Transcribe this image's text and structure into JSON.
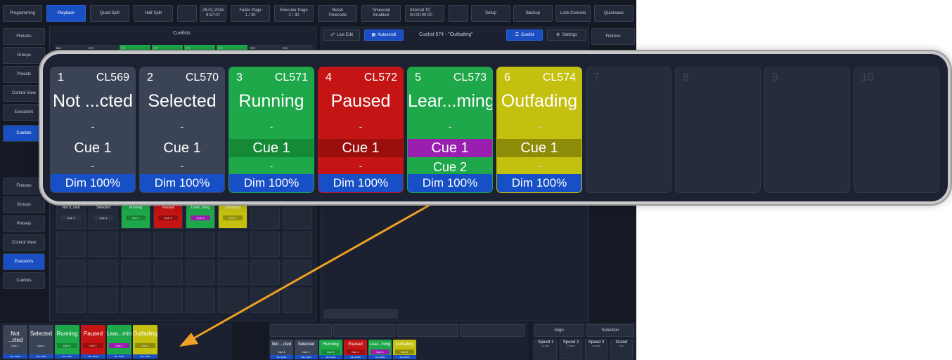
{
  "colors": {
    "accent_blue": "#1a4fc4",
    "green": "#1ea84a",
    "red": "#c41414",
    "purple": "#9a1fb0",
    "yellow": "#c4c010",
    "arrow": "#f0a024",
    "panel_bg": "#1b2130"
  },
  "topbar": {
    "b1": "Programming",
    "b2": "Playback",
    "b3": "Quad Split",
    "b4": "Half Split",
    "date": "25.01.2016",
    "time": "9:57:07",
    "fader_page_label": "Fader Page",
    "fader_page_value": "1 / 30",
    "exec_page_label": "Executor Page",
    "exec_page_value": "2 / 30",
    "reset_label": "Reset",
    "reset_sub": "Timecode",
    "timecode_label": "Timecode",
    "timecode_sub": "Enabled",
    "internal_tc_label": "Internal TC",
    "internal_tc_value": "00:00:00:00",
    "setup": "Setup",
    "backup": "Backup",
    "lock": "Lock Console",
    "quickmode": "Quicksave"
  },
  "left_top": [
    "Fixtures",
    "Groups",
    "Presets",
    "Control View",
    "Executors",
    "Cuelists"
  ],
  "left_bottom": [
    "Fixtures",
    "Groups",
    "Presets",
    "Control View",
    "Executors",
    "Cuelists"
  ],
  "right": {
    "fixtures": "Fixtures",
    "align": "Align",
    "selection": "Selection"
  },
  "cuelists_panel": {
    "title": "Cuelists",
    "band": [
      "569",
      "570",
      "571",
      "572",
      "573",
      "574",
      "575",
      "576"
    ]
  },
  "cuelist_view": {
    "live_edit": "Live Edit",
    "autoscroll": "Autoscroll",
    "title": "Cuelist 574 - \"Outfading\"",
    "cuelist_btn": "Cuelist",
    "settings_btn": "Settings"
  },
  "small_cells": [
    {
      "name": "Not S..cted",
      "cue": "Cue 1"
    },
    {
      "name": "Selected",
      "cue": "Cue 1"
    },
    {
      "name": "Running",
      "cue": "Cue 1"
    },
    {
      "name": "Paused",
      "cue": "Cue 1"
    },
    {
      "name": "Learn..ming",
      "cue": "Cue 1"
    },
    {
      "name": "Outfading",
      "cue": "Cue 1"
    }
  ],
  "zoom": {
    "cells": [
      {
        "num": "1",
        "cl": "CL569",
        "name": "Not ...cted",
        "dash1": "-",
        "cue": "Cue 1",
        "dash2": "-",
        "dim": "Dim 100%"
      },
      {
        "num": "2",
        "cl": "CL570",
        "name": "Selected",
        "dash1": "-",
        "cue": "Cue 1",
        "dash2": "-",
        "dim": "Dim 100%"
      },
      {
        "num": "3",
        "cl": "CL571",
        "name": "Running",
        "dash1": "-",
        "cue": "Cue 1",
        "dash2": "-",
        "dim": "Dim 100%"
      },
      {
        "num": "4",
        "cl": "CL572",
        "name": "Paused",
        "dash1": "-",
        "cue": "Cue 1",
        "dash2": "-",
        "dim": "Dim 100%"
      },
      {
        "num": "5",
        "cl": "CL573",
        "name": "Lear...ming",
        "dash1": "-",
        "cue": "Cue 1",
        "cue2": "Cue 2",
        "dim": "Dim 100%"
      },
      {
        "num": "6",
        "cl": "CL574",
        "name": "Outfading",
        "dash1": "-",
        "cue": "Cue 1",
        "dash2": "-",
        "dim": "Dim 100%"
      }
    ],
    "empty": [
      "7",
      "8",
      "9",
      "10"
    ]
  },
  "bottom": {
    "mini": [
      {
        "name": "Not ...cted",
        "cue": "Cue 1",
        "dim": "Dim 100%"
      },
      {
        "name": "Selected",
        "cue": "Cue 1",
        "dim": "Dim 100%"
      },
      {
        "name": "Running",
        "cue": "Cue 1",
        "dim": "Dim 100%"
      },
      {
        "name": "Paused",
        "cue": "Cue 1",
        "dim": "Dim 100%"
      },
      {
        "name": "Lear...ming",
        "cue": "Cue 1",
        "dim": "Dim 100%"
      },
      {
        "name": "Outfading",
        "cue": "Cue 1",
        "dim": "Dim 100%"
      }
    ],
    "speeds": [
      {
        "label": "Speed 1",
        "value": "60 BPM"
      },
      {
        "label": "Speed 2",
        "value": "60 BPM"
      },
      {
        "label": "Speed 3",
        "value": "60 BPM"
      },
      {
        "label": "Grand",
        "value": "100%"
      }
    ]
  }
}
